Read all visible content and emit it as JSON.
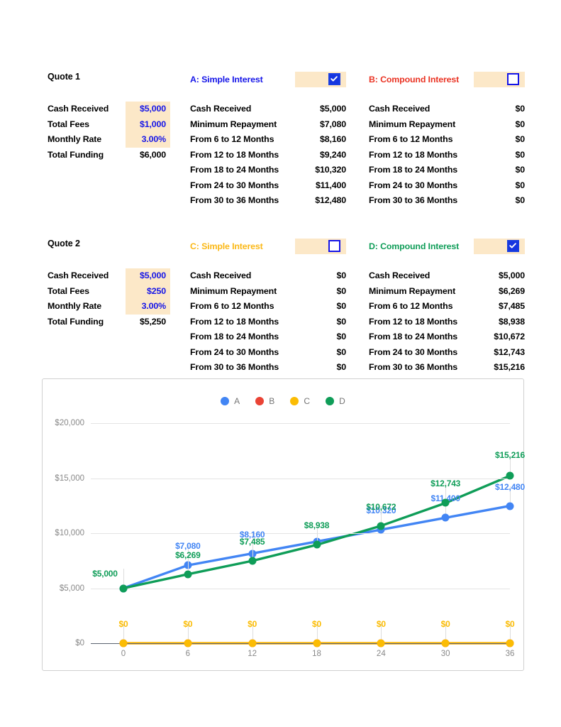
{
  "colors": {
    "series_a": "#4285F4",
    "series_b": "#EA4335",
    "series_c": "#FBBC04",
    "series_d": "#0F9D58",
    "input_cell_bg": "#FCE8C8",
    "input_cell_text": "#1515E8",
    "checkbox": "#1535E0",
    "title_a": "#1515E8",
    "title_b": "#EA3323",
    "title_c": "#FBB816",
    "title_d": "#0F9D58",
    "axis_text": "#888888",
    "gridline": "#E4E4E4"
  },
  "quotes": [
    {
      "title": "Quote 1",
      "summary": [
        {
          "label": "Cash Received",
          "value": "$5,000",
          "kind": "input"
        },
        {
          "label": "Total Fees",
          "value": "$1,000",
          "kind": "input"
        },
        {
          "label": "Monthly Rate",
          "value": "3.00%",
          "kind": "input"
        },
        {
          "label": "Total Funding",
          "value": "$6,000",
          "kind": "total"
        }
      ],
      "options": [
        {
          "id": "A",
          "title": "A: Simple Interest",
          "color": "#1515E8",
          "checked": true,
          "rows": [
            {
              "label": "Cash Received",
              "value": "$5,000"
            },
            {
              "label": "Minimum Repayment",
              "value": "$7,080"
            },
            {
              "label": "From 6 to 12 Months",
              "value": "$8,160"
            },
            {
              "label": "From 12 to 18 Months",
              "value": "$9,240"
            },
            {
              "label": "From 18 to 24 Months",
              "value": "$10,320"
            },
            {
              "label": "From 24 to 30 Months",
              "value": "$11,400"
            },
            {
              "label": "From 30 to 36 Months",
              "value": "$12,480"
            }
          ]
        },
        {
          "id": "B",
          "title": "B: Compound Interest",
          "color": "#EA3323",
          "checked": false,
          "rows": [
            {
              "label": "Cash Received",
              "value": "$0"
            },
            {
              "label": "Minimum Repayment",
              "value": "$0"
            },
            {
              "label": "From 6 to 12 Months",
              "value": "$0"
            },
            {
              "label": "From 12 to 18 Months",
              "value": "$0"
            },
            {
              "label": "From 18 to 24 Months",
              "value": "$0"
            },
            {
              "label": "From 24 to 30 Months",
              "value": "$0"
            },
            {
              "label": "From 30 to 36 Months",
              "value": "$0"
            }
          ]
        }
      ]
    },
    {
      "title": "Quote 2",
      "summary": [
        {
          "label": "Cash Received",
          "value": "$5,000",
          "kind": "input"
        },
        {
          "label": "Total Fees",
          "value": "$250",
          "kind": "input"
        },
        {
          "label": "Monthly Rate",
          "value": "3.00%",
          "kind": "input"
        },
        {
          "label": "Total Funding",
          "value": "$5,250",
          "kind": "total"
        }
      ],
      "options": [
        {
          "id": "C",
          "title": "C: Simple Interest",
          "color": "#FBB816",
          "checked": false,
          "rows": [
            {
              "label": "Cash Received",
              "value": "$0"
            },
            {
              "label": "Minimum Repayment",
              "value": "$0"
            },
            {
              "label": "From 6 to 12 Months",
              "value": "$0"
            },
            {
              "label": "From 12 to 18 Months",
              "value": "$0"
            },
            {
              "label": "From 18 to 24 Months",
              "value": "$0"
            },
            {
              "label": "From 24 to 30 Months",
              "value": "$0"
            },
            {
              "label": "From 30 to 36 Months",
              "value": "$0"
            }
          ]
        },
        {
          "id": "D",
          "title": "D: Compound Interest",
          "color": "#0F9D58",
          "checked": true,
          "rows": [
            {
              "label": "Cash Received",
              "value": "$5,000"
            },
            {
              "label": "Minimum Repayment",
              "value": "$6,269"
            },
            {
              "label": "From 6 to 12 Months",
              "value": "$7,485"
            },
            {
              "label": "From 12 to 18 Months",
              "value": "$8,938"
            },
            {
              "label": "From 18 to 24 Months",
              "value": "$10,672"
            },
            {
              "label": "From 24 to 30 Months",
              "value": "$12,743"
            },
            {
              "label": "From 30 to 36 Months",
              "value": "$15,216"
            }
          ]
        }
      ]
    }
  ],
  "chart_data": {
    "type": "line",
    "title": "",
    "xlabel": "",
    "ylabel": "",
    "x": [
      0,
      6,
      12,
      18,
      24,
      30,
      36
    ],
    "xtick_labels": [
      "0",
      "6",
      "12",
      "18",
      "24",
      "30",
      "36"
    ],
    "ytick_labels": [
      "$0",
      "$5,000",
      "$10,000",
      "$15,000",
      "$20,000"
    ],
    "yticks": [
      0,
      5000,
      10000,
      15000,
      20000
    ],
    "ylim": [
      0,
      20000
    ],
    "grid": true,
    "legend_position": "top-center",
    "series": [
      {
        "name": "A",
        "color": "#4285F4",
        "values": [
          5000,
          7080,
          8160,
          9240,
          10320,
          11400,
          12480
        ],
        "labels": [
          "$5,000",
          "$7,080",
          "$8,160",
          "$9,240",
          "$10,320",
          "$11,400",
          "$12,480"
        ],
        "show_labels": [
          false,
          true,
          true,
          false,
          true,
          true,
          true
        ]
      },
      {
        "name": "B",
        "color": "#EA4335",
        "values": [
          0,
          0,
          0,
          0,
          0,
          0,
          0
        ],
        "labels": [
          "$0",
          "$0",
          "$0",
          "$0",
          "$0",
          "$0",
          "$0"
        ],
        "show_labels": [
          false,
          false,
          false,
          false,
          false,
          false,
          false
        ]
      },
      {
        "name": "C",
        "color": "#FBBC04",
        "values": [
          0,
          0,
          0,
          0,
          0,
          0,
          0
        ],
        "labels": [
          "$0",
          "$0",
          "$0",
          "$0",
          "$0",
          "$0",
          "$0"
        ],
        "show_labels": [
          true,
          true,
          true,
          true,
          true,
          true,
          true
        ]
      },
      {
        "name": "D",
        "color": "#0F9D58",
        "values": [
          5000,
          6269,
          7485,
          8938,
          10672,
          12743,
          15216
        ],
        "labels": [
          "$5,000",
          "$6,269",
          "$7,485",
          "$8,938",
          "$10,672",
          "$12,743",
          "$15,216"
        ],
        "show_labels": [
          true,
          true,
          true,
          true,
          true,
          true,
          true
        ]
      }
    ],
    "legend": [
      {
        "name": "A",
        "color": "#4285F4"
      },
      {
        "name": "B",
        "color": "#EA4335"
      },
      {
        "name": "C",
        "color": "#FBBC04"
      },
      {
        "name": "D",
        "color": "#0F9D58"
      }
    ]
  }
}
